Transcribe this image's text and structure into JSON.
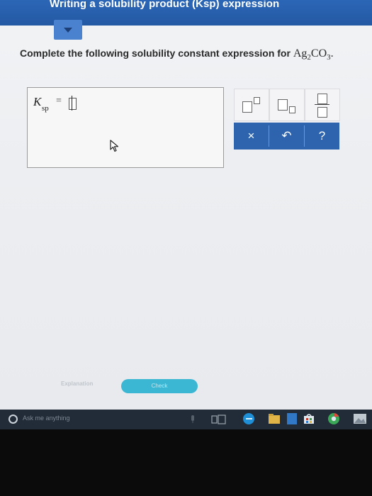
{
  "header": {
    "title": "Writing a solubility product (Ksp) expression"
  },
  "question": {
    "prefix": "Complete the following solubility constant expression for",
    "formula_ag": "Ag",
    "formula_ag_sub": "2",
    "formula_co": "CO",
    "formula_co_sub": "3",
    "suffix": "."
  },
  "answer": {
    "k_symbol": "K",
    "k_subscript": "sp",
    "equals": "="
  },
  "tools": {
    "superscript_label": "superscript",
    "subscript_label": "subscript",
    "fraction_label": "fraction",
    "clear_symbol": "×",
    "undo_symbol": "↶",
    "help_symbol": "?"
  },
  "footer": {
    "explanation_label": "Explanation",
    "check_label": "Check"
  },
  "taskbar": {
    "search_placeholder": "Ask me anything"
  },
  "colors": {
    "header": "#2b66b6",
    "accent": "#3bb6d3",
    "action_row": "#2e63ad"
  }
}
